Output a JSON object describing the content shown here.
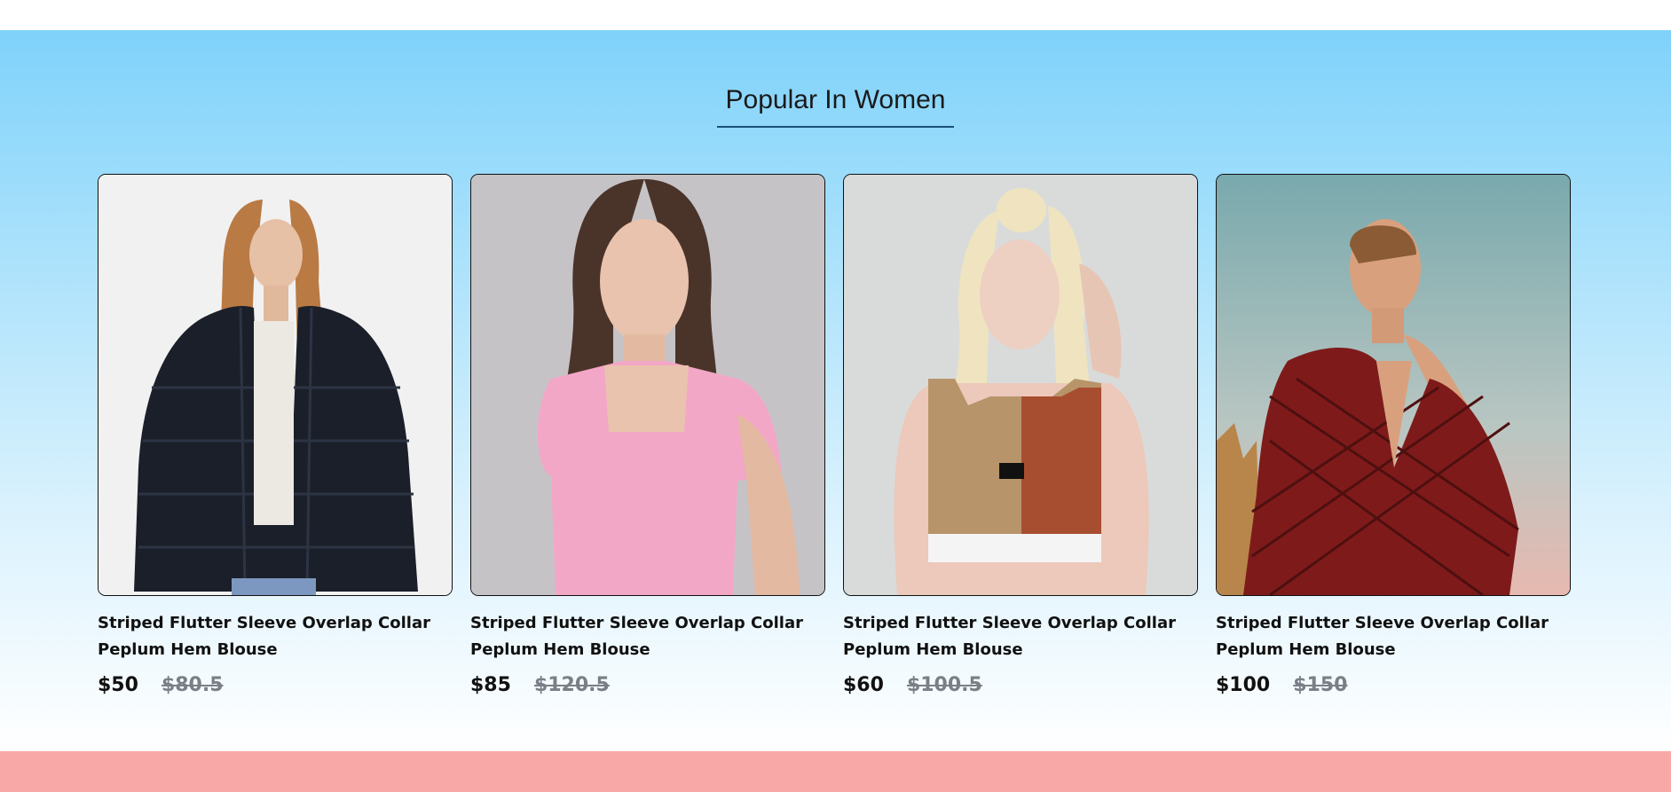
{
  "section": {
    "title": "Popular In Women"
  },
  "products": [
    {
      "name": "Striped Flutter Sleeve Overlap Collar Peplum Hem Blouse",
      "price": "$50",
      "old_price": "$80.5",
      "image_icon": "woman-fur-jacket-photo"
    },
    {
      "name": "Striped Flutter Sleeve Overlap Collar Peplum Hem Blouse",
      "price": "$85",
      "old_price": "$120.5",
      "image_icon": "woman-pink-top-photo"
    },
    {
      "name": "Striped Flutter Sleeve Overlap Collar Peplum Hem Blouse",
      "price": "$60",
      "old_price": "$100.5",
      "image_icon": "woman-sports-bra-photo"
    },
    {
      "name": "Striped Flutter Sleeve Overlap Collar Peplum Hem Blouse",
      "price": "$100",
      "old_price": "$150",
      "image_icon": "woman-red-dress-photo"
    }
  ],
  "colors": {
    "gradient_top": "#7fd2fb",
    "gradient_bottom": "#ffffff",
    "footer_band": "#f9a8a8",
    "old_price": "#7a7f87"
  }
}
